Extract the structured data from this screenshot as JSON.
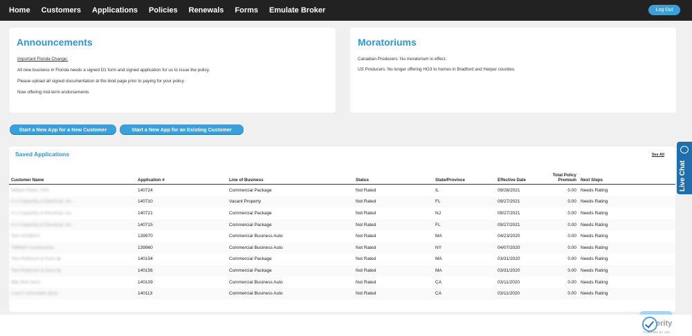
{
  "nav": {
    "items": [
      "Home",
      "Customers",
      "Applications",
      "Policies",
      "Renewals",
      "Forms",
      "Emulate Broker"
    ],
    "logout_label": "Log Out"
  },
  "announcements": {
    "title": "Announcements",
    "lines": [
      "Important Florida Change:",
      "All new business in Florida needs a signed D1 form and signed application for us to issue the policy.",
      "Please upload all signed documentation at the bind page prior to paying for your policy.",
      "Now offering mid-term endorsements"
    ]
  },
  "moratoriums": {
    "title": "Moratoriums",
    "lines": [
      "Canadian Producers: No moratorium in effect.",
      "US Producers: No longer offering HO3 to homes in Bradford and Harper counties."
    ]
  },
  "actions": {
    "new_customer": "Start a New App for a New Customer",
    "existing_customer": "Start a New App for an Existing Customer"
  },
  "saved": {
    "title": "Saved Applications",
    "see_all": "See All",
    "columns": [
      "Customer Name",
      "Application #",
      "Line of Business",
      "Status",
      "State/Province",
      "Effective Date",
      "Total Policy Premium",
      "Next Steps"
    ],
    "rows": [
      [
        "William Reed, CPA",
        "140724",
        "Commercial Package",
        "Not Rated",
        "IL",
        "09/28/2021",
        "0.00",
        "Needs Rating"
      ],
      [
        "A-1 Carpentry & Electrical, Inc.",
        "140710",
        "Vacant Property",
        "Not Rated",
        "FL",
        "09/27/2021",
        "0.00",
        "Needs Rating"
      ],
      [
        "A-1 Carpentry & Electrical, Inc.",
        "140721",
        "Commercial Package",
        "Not Rated",
        "NJ",
        "09/27/2021",
        "0.00",
        "Needs Rating"
      ],
      [
        "A-1 Carpentry & Electrical, Inc.",
        "140715",
        "Commercial Package",
        "Not Rated",
        "FL",
        "09/27/2021",
        "0.00",
        "Needs Rating"
      ],
      [
        "Test 2019MA3",
        "139970",
        "Commercial Business Auto",
        "Not Rated",
        "MA",
        "04/23/2020",
        "0.00",
        "Needs Rating"
      ],
      [
        "TMRMS Construction",
        "139960",
        "Commercial Business Auto",
        "Not Rated",
        "NY",
        "04/07/2020",
        "0.00",
        "Needs Rating"
      ],
      [
        "Test Robinson & Sons llp",
        "140154",
        "Commercial Package",
        "Not Rated",
        "MA",
        "03/31/2020",
        "0.00",
        "Needs Rating"
      ],
      [
        "Test Robinson & Sons llp",
        "140156",
        "Commercial Package",
        "Not Rated",
        "MA",
        "03/31/2020",
        "0.00",
        "Needs Rating"
      ],
      [
        "Billy Bob (test)",
        "140109",
        "Commercial Business Auto",
        "Not Rated",
        "CA",
        "03/11/2020",
        "0.00",
        "Needs Rating"
      ],
      [
        "Lucy's Lemonade (test)",
        "140113",
        "Commercial Business Auto",
        "Not Rated",
        "CA",
        "03/11/2020",
        "0.00",
        "Needs Rating"
      ]
    ]
  },
  "livechat": {
    "label": "Live Chat"
  },
  "footer": {
    "logo_word": "erity",
    "logo_sub": "POWERED BY VRC"
  }
}
